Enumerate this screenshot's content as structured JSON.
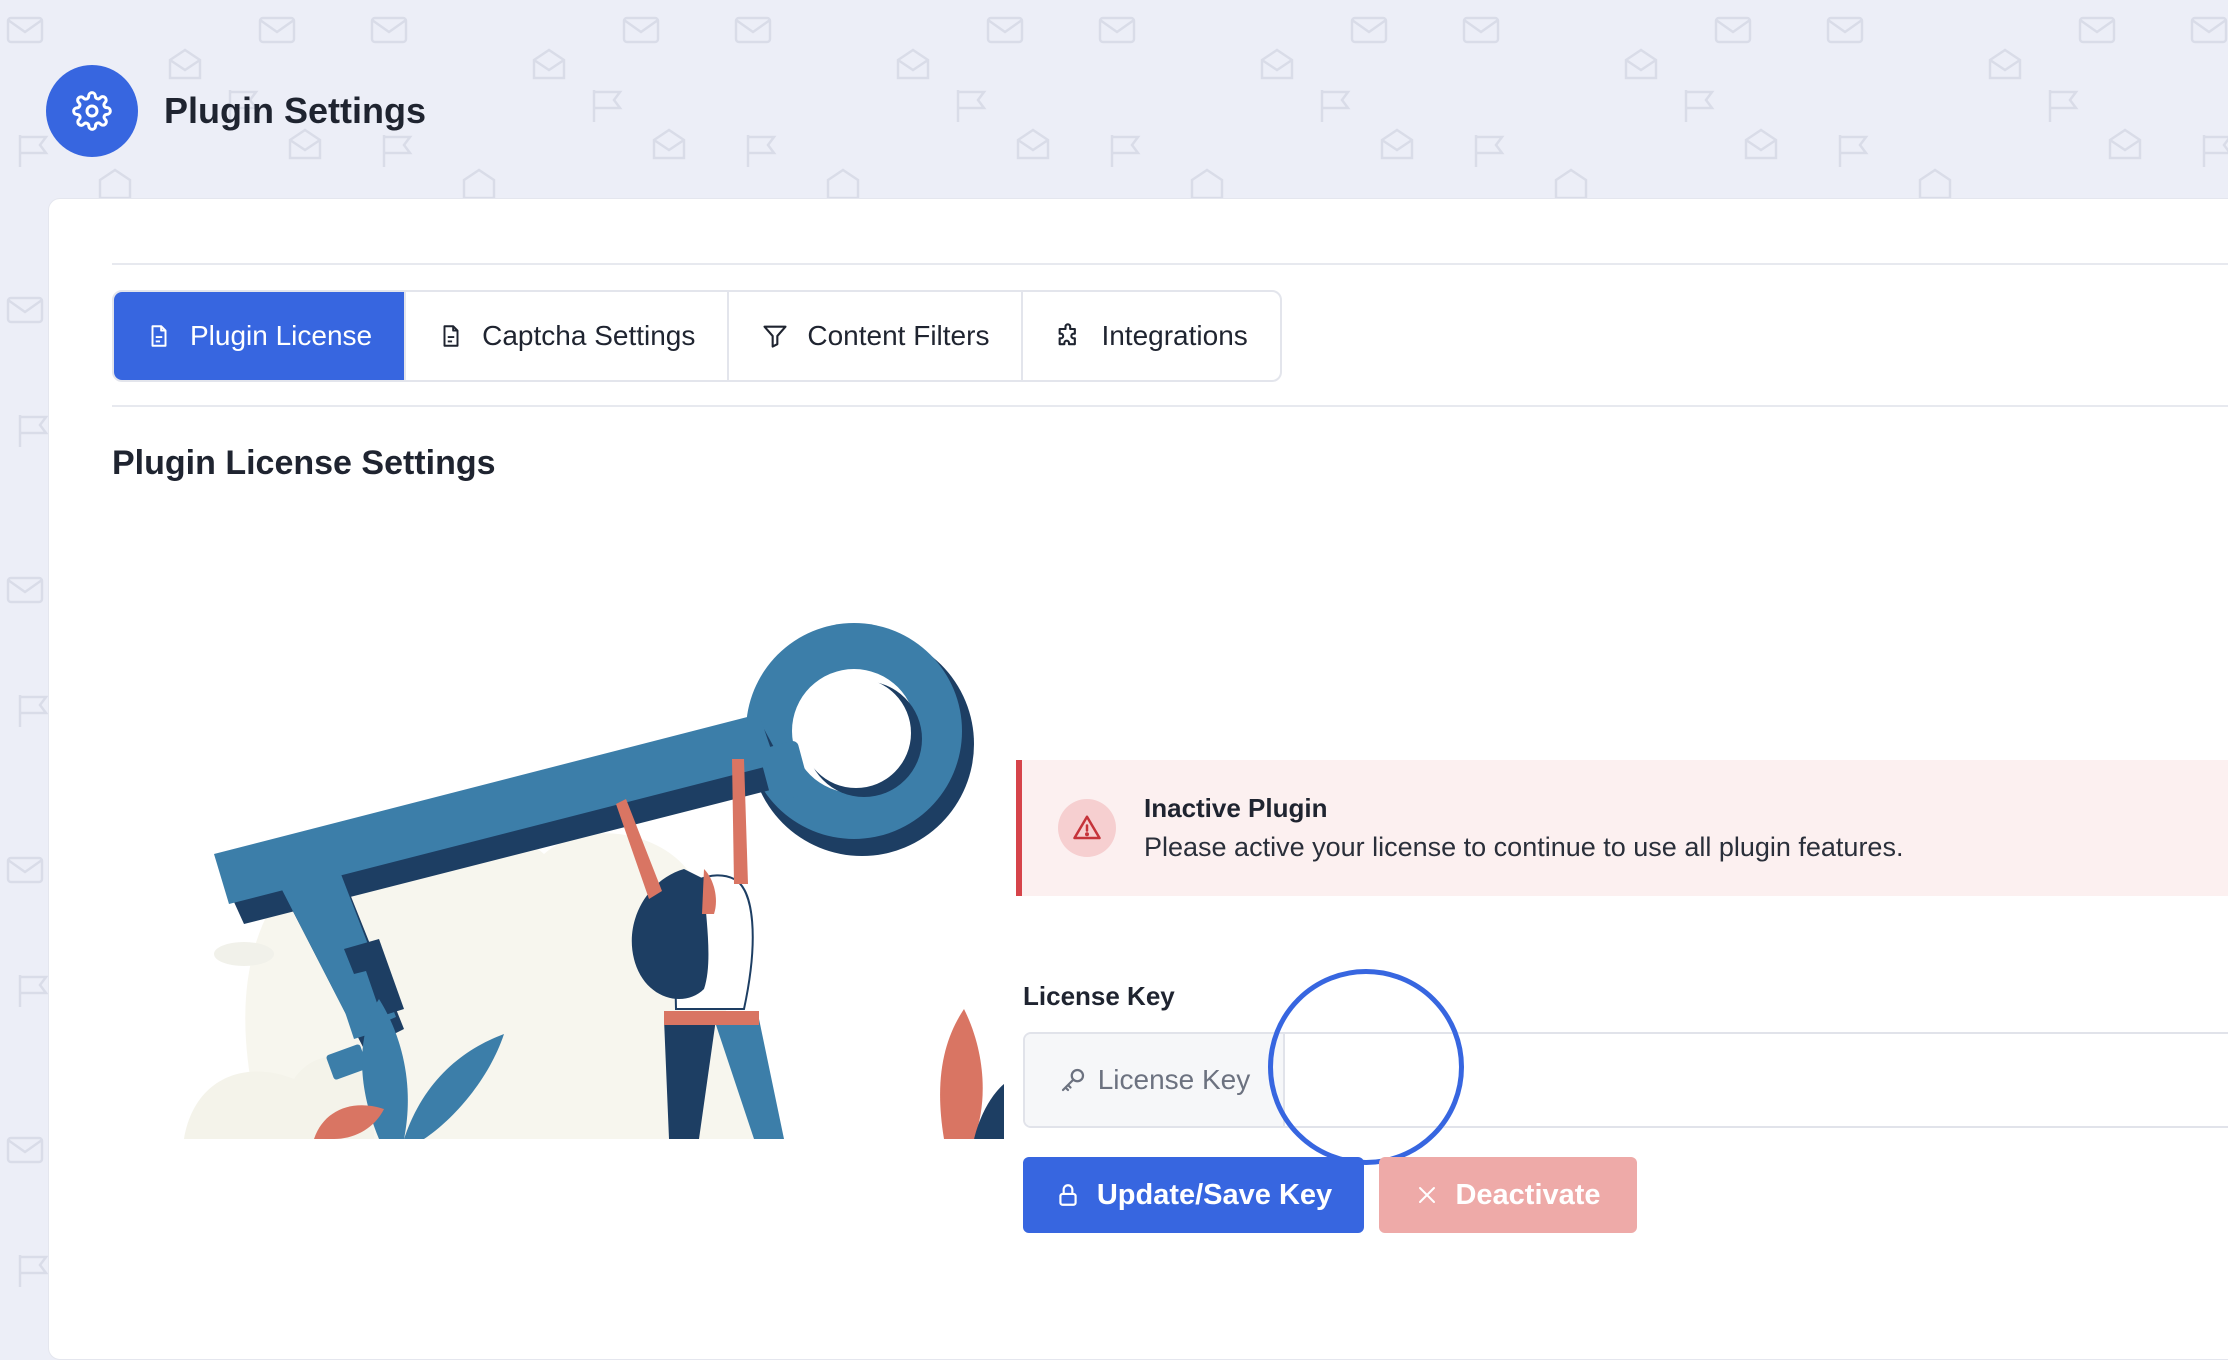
{
  "header": {
    "title": "Plugin Settings",
    "icon": "gear-icon"
  },
  "tabs": [
    {
      "label": "Plugin License",
      "icon": "document-icon",
      "active": true
    },
    {
      "label": "Captcha Settings",
      "icon": "document-icon",
      "active": false
    },
    {
      "label": "Content Filters",
      "icon": "filter-icon",
      "active": false
    },
    {
      "label": "Integrations",
      "icon": "puzzle-icon",
      "active": false
    }
  ],
  "section": {
    "title": "Plugin License Settings"
  },
  "alert": {
    "icon": "warning-icon",
    "title": "Inactive Plugin",
    "message": "Please active your license to continue to use all plugin features."
  },
  "license_form": {
    "label": "License Key",
    "addon_text": "License Key",
    "addon_icon": "key-icon",
    "value": ""
  },
  "buttons": {
    "save_label": "Update/Save Key",
    "save_icon": "lock-icon",
    "deactivate_label": "Deactivate",
    "deactivate_icon": "close-icon"
  },
  "colors": {
    "primary": "#3766e0",
    "danger": "#d6444a",
    "danger_light": "#eeaaa8",
    "alert_bg": "#fcf0f0",
    "page_bg": "#eceef7"
  }
}
